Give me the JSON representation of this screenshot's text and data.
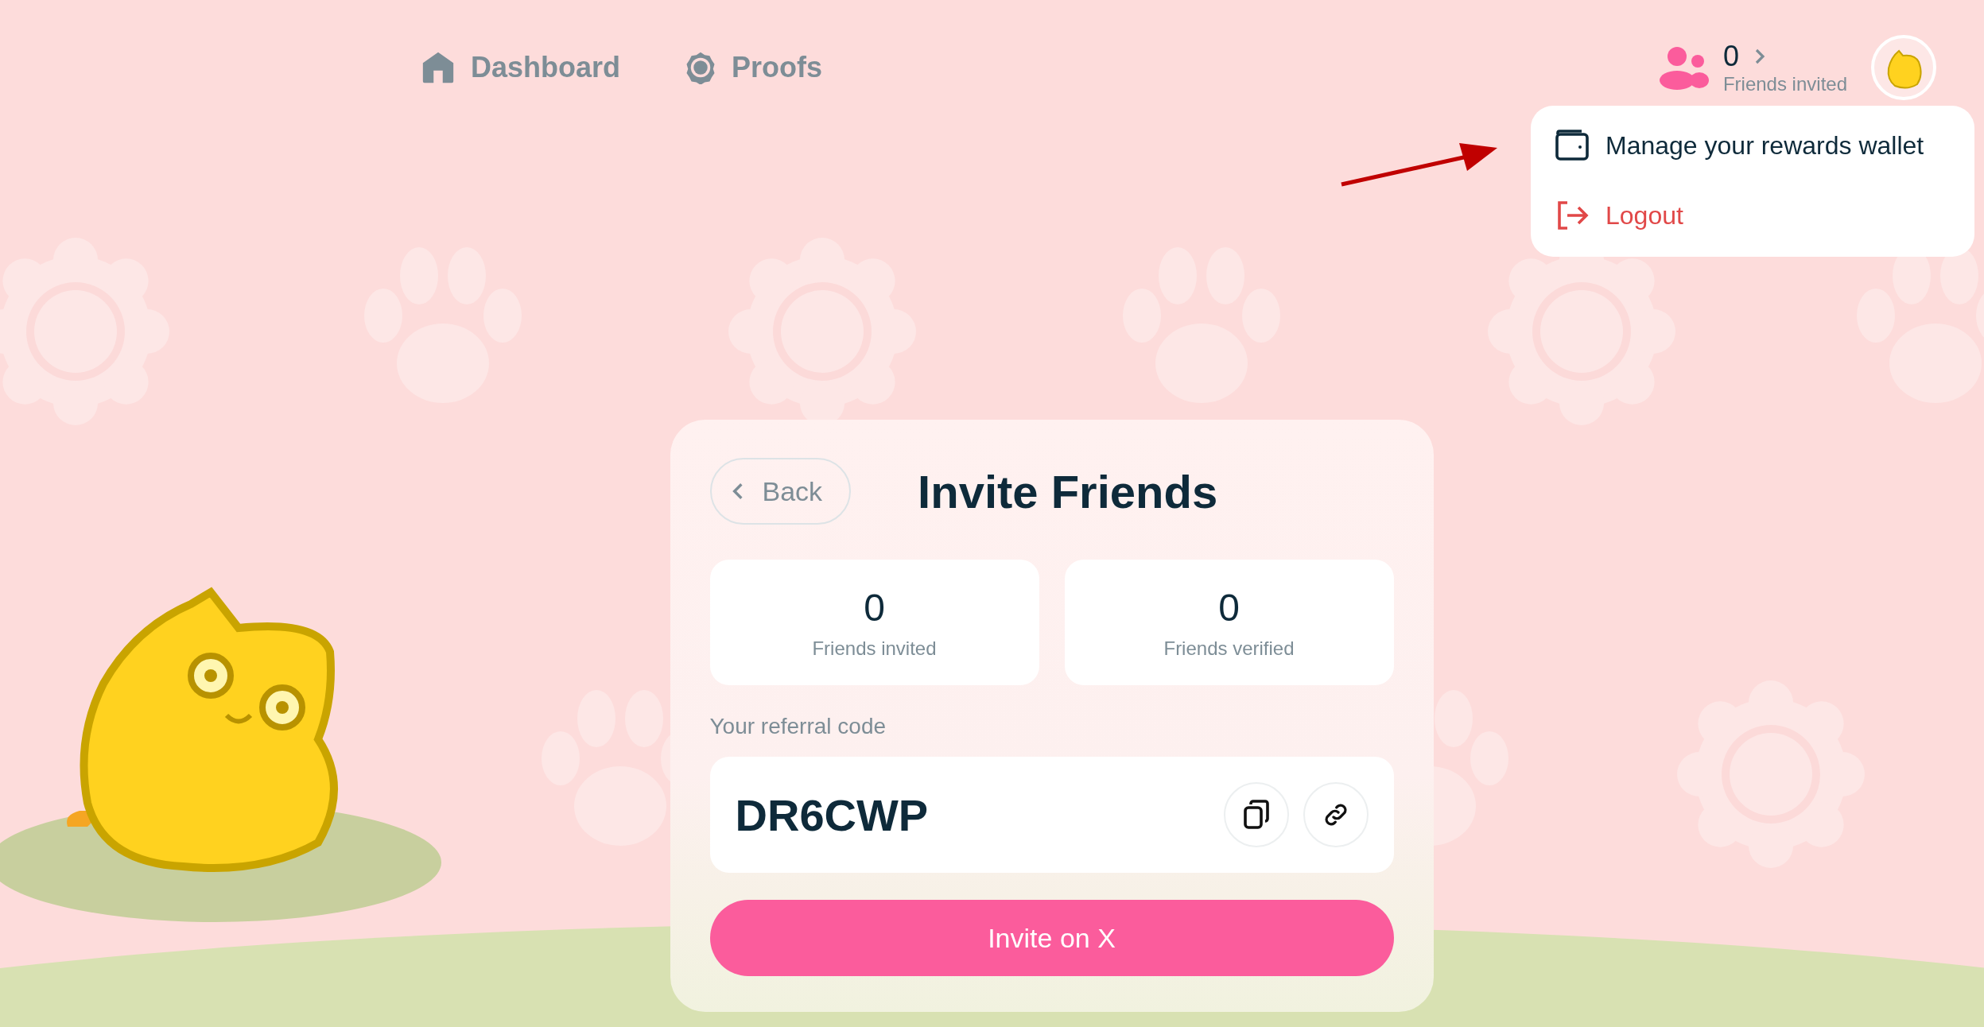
{
  "nav": [
    {
      "label": "Dashboard",
      "kind": "home"
    },
    {
      "label": "Proofs",
      "kind": "badge"
    }
  ],
  "friends_counter": {
    "count": "0",
    "label": "Friends invited"
  },
  "user_menu": {
    "items": [
      {
        "label": "Manage your rewards wallet",
        "kind": "wallet"
      },
      {
        "label": "Logout",
        "kind": "logout"
      }
    ]
  },
  "card": {
    "back": "Back",
    "title": "Invite Friends",
    "stats": [
      {
        "value": "0",
        "label": "Friends invited"
      },
      {
        "value": "0",
        "label": "Friends verified"
      }
    ],
    "referral_label": "Your referral code",
    "referral_code": "DR6CWP",
    "invite_button": "Invite on X"
  }
}
